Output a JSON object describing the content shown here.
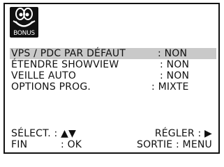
{
  "badge": {
    "text": "BONUS"
  },
  "menu": {
    "items": [
      {
        "label": "VPS / PDC PAR DÉFAUT",
        "value": ": NON"
      },
      {
        "label": "ÉTENDRE SHOWVIEW",
        "value": ": NON"
      },
      {
        "label": "VEILLE AUTO",
        "value": ": NON"
      },
      {
        "label": "OPTIONS PROG.",
        "value": ": MIXTE"
      }
    ]
  },
  "footer": {
    "select": "SÉLECT. : ▲▼",
    "adjust": "RÉGLER : ▶",
    "end": "FIN",
    "end_key": ": OK",
    "exit": "SORTIE : MENU"
  }
}
